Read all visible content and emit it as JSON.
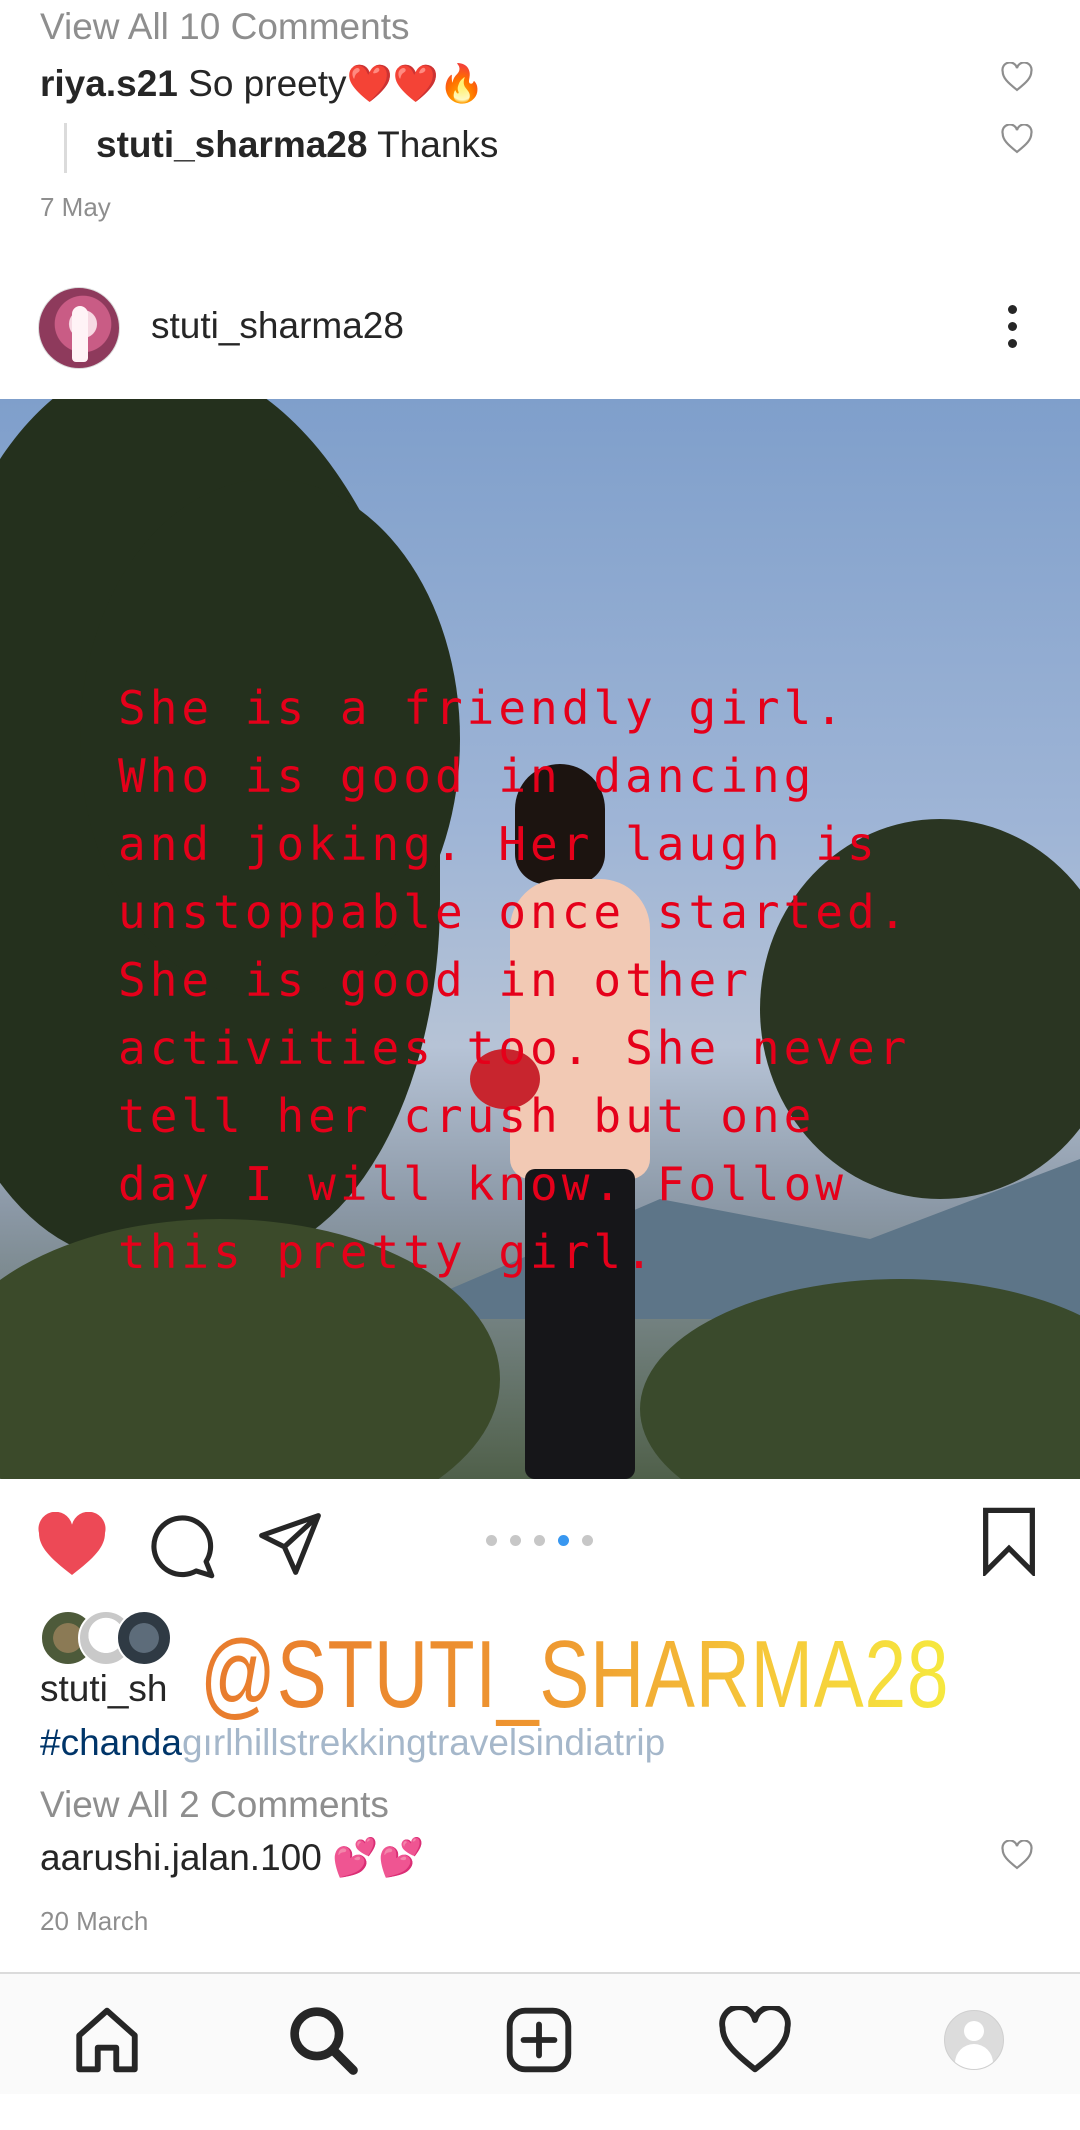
{
  "prev_post": {
    "view_all_comments": "View All 10 Comments",
    "comments": [
      {
        "user": "riya.s21",
        "text": "So preety",
        "emoji": "❤️❤️🔥"
      },
      {
        "user": "stuti_sharma28",
        "text": "Thanks",
        "is_reply": true
      }
    ],
    "date": "7 May"
  },
  "post": {
    "username": "stuti_sharma28",
    "photo_text": "She is a friendly girl.\nWho is good in dancing\nand joking. Her laugh is\nunstoppable once started.\nShe is good in other\nactivities too. She never\ntell her crush but one\nday I will know. Follow\nthis pretty girl.",
    "carousel": {
      "count": 5,
      "active_index": 3
    },
    "liked": true,
    "caption_user": "stuti_sh",
    "watermark": "@STUTI_SHARMA28",
    "hashtags_visible": "#chanda",
    "hashtags_faded": "gırlhillstrekkingtravelsindiatrip",
    "view_all_comments": "View All 2 Comments",
    "comments": [
      {
        "user": "aarushi.jalan.100",
        "emoji": "💕💕"
      }
    ],
    "date": "20 March"
  },
  "bottom_nav": {
    "items": [
      "home-icon",
      "search-icon",
      "add-post-icon",
      "activity-heart-icon",
      "profile-avatar-icon"
    ]
  },
  "colors": {
    "like_red": "#ed4956",
    "overlay_text": "#e5001a",
    "carousel_active": "#3897f0",
    "hashtag": "#003569"
  }
}
